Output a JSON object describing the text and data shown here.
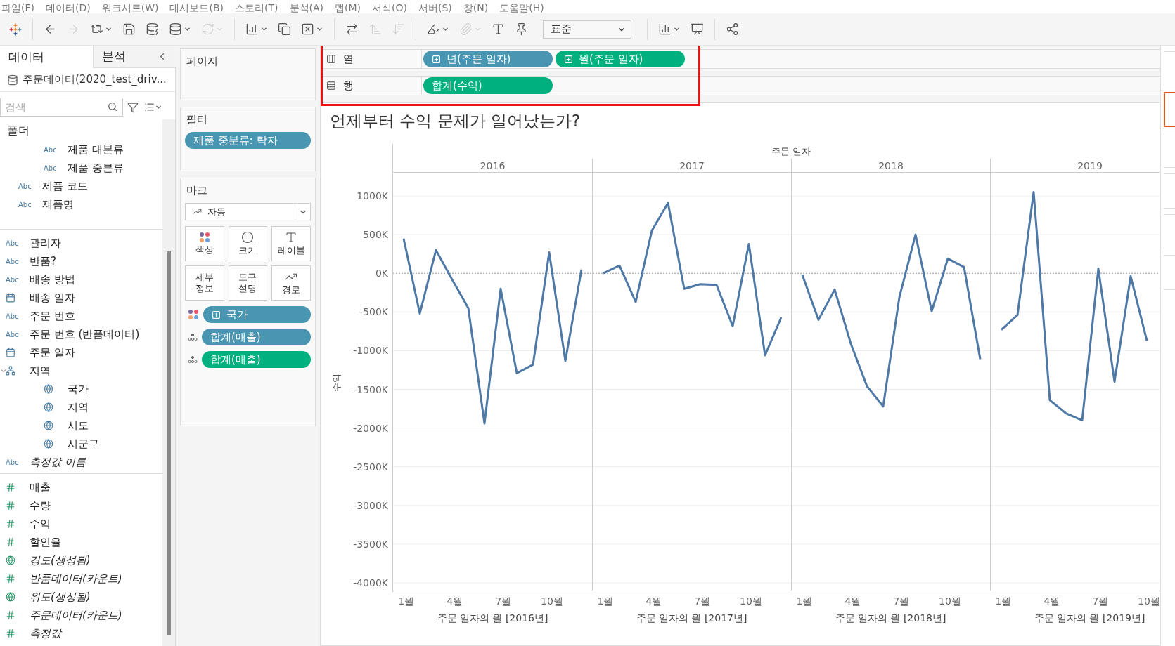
{
  "menu_bar": [
    "파일(F)",
    "데이터(D)",
    "워크시트(W)",
    "대시보드(B)",
    "스토리(T)",
    "분석(A)",
    "맵(M)",
    "서식(O)",
    "서버(S)",
    "창(N)",
    "도움말(H)"
  ],
  "toolbar": [
    {
      "kind": "logo"
    },
    {
      "kind": "separator"
    },
    {
      "kind": "back",
      "disabled": false,
      "menu": false
    },
    {
      "kind": "forward",
      "disabled": true,
      "menu": false
    },
    {
      "kind": "redo",
      "disabled": false,
      "menu": true
    },
    {
      "kind": "save",
      "disabled": false,
      "menu": false
    },
    {
      "kind": "new_datasource",
      "disabled": false,
      "menu": false
    },
    {
      "kind": "pause",
      "disabled": false,
      "menu": true
    },
    {
      "kind": "refresh",
      "disabled": true,
      "menu": true
    },
    {
      "kind": "separator"
    },
    {
      "kind": "new_sheet",
      "disabled": false,
      "menu": true
    },
    {
      "kind": "duplicate",
      "disabled": false,
      "menu": false
    },
    {
      "kind": "clear",
      "disabled": false,
      "menu": true
    },
    {
      "kind": "separator"
    },
    {
      "kind": "swap",
      "disabled": false,
      "menu": false
    },
    {
      "kind": "sort_asc",
      "disabled": true,
      "menu": false
    },
    {
      "kind": "sort_desc",
      "disabled": true,
      "menu": false
    },
    {
      "kind": "separator"
    },
    {
      "kind": "highlight",
      "disabled": false,
      "menu": true
    },
    {
      "kind": "annotate",
      "disabled": true,
      "menu": true
    },
    {
      "kind": "text",
      "disabled": false,
      "menu": false
    },
    {
      "kind": "pin",
      "disabled": false,
      "menu": false
    },
    {
      "kind": "select",
      "value": "표준"
    },
    {
      "kind": "separator"
    },
    {
      "kind": "show_me",
      "disabled": false,
      "menu": true
    },
    {
      "kind": "present",
      "disabled": false,
      "menu": false
    },
    {
      "kind": "separator"
    },
    {
      "kind": "share",
      "disabled": false,
      "menu": false
    }
  ],
  "data_pane": {
    "tabs": [
      {
        "label": "데이터",
        "selected": true
      },
      {
        "label": "분석",
        "selected": false
      }
    ],
    "datasource": "주문데이터(2020_test_driv...",
    "search": {
      "placeholder": "검색"
    },
    "folder_heading": "폴더",
    "sections": [
      {
        "measures": false,
        "items": [
          {
            "children": [
              {
                "kind": "text",
                "type_label": "Abc",
                "label": "제품 대분류",
                "italic": false
              },
              {
                "kind": "text",
                "type_label": "Abc",
                "label": "제품 중분류",
                "italic": false
              }
            ]
          },
          {
            "kind": "text",
            "type_label": "Abc",
            "label": "제품 코드",
            "italic": false
          },
          {
            "kind": "text",
            "type_label": "Abc",
            "label": "제품명",
            "italic": false
          }
        ]
      },
      {
        "measures": false,
        "items": [
          {
            "kind": "text",
            "type_label": "Abc",
            "label": "관리자",
            "italic": false
          },
          {
            "kind": "text",
            "type_label": "Abc",
            "label": "반품?",
            "italic": false
          },
          {
            "kind": "text",
            "type_label": "Abc",
            "label": "배송 방법",
            "italic": false
          },
          {
            "kind": "date",
            "label": "배송 일자",
            "italic": false
          },
          {
            "kind": "text",
            "type_label": "Abc",
            "label": "주문 번호",
            "italic": false
          },
          {
            "kind": "text",
            "type_label": "Abc",
            "label": "주문 번호 (반품데이터)",
            "italic": false
          },
          {
            "kind": "date",
            "label": "주문 일자",
            "italic": false
          },
          {
            "kind": "hierarchy",
            "label": "지역",
            "italic": false,
            "expanded": true,
            "children": [
              {
                "kind": "geo",
                "label": "국가",
                "italic": false
              },
              {
                "kind": "geo",
                "label": "지역",
                "italic": false
              },
              {
                "kind": "geo",
                "label": "시도",
                "italic": false
              },
              {
                "kind": "geo",
                "label": "시군구",
                "italic": false
              }
            ]
          },
          {
            "kind": "text",
            "type_label": "Abc",
            "label": "측정값 이름",
            "italic": true
          }
        ]
      },
      {
        "measures": true,
        "items": [
          {
            "kind": "number",
            "label": "매출",
            "italic": false
          },
          {
            "kind": "number",
            "label": "수량",
            "italic": false
          },
          {
            "kind": "number",
            "label": "수익",
            "italic": false
          },
          {
            "kind": "number",
            "label": "할인율",
            "italic": false
          },
          {
            "kind": "geo",
            "label": "경도(생성됨)",
            "italic": true
          },
          {
            "kind": "number",
            "label": "반품데이터(카운트)",
            "italic": true
          },
          {
            "kind": "geo",
            "label": "위도(생성됨)",
            "italic": true
          },
          {
            "kind": "number",
            "label": "주문데이터(카운트)",
            "italic": true
          },
          {
            "kind": "number",
            "label": "측정값",
            "italic": true
          }
        ]
      }
    ]
  },
  "pages_card": {
    "title": "페이지"
  },
  "filters_card": {
    "title": "필터",
    "pills": [
      {
        "label": "제품 중분류: 탁자",
        "continuous": false
      }
    ]
  },
  "marks_card": {
    "title": "마크",
    "mark_type": "자동",
    "buttons": [
      {
        "kind": "color",
        "label": "색상"
      },
      {
        "kind": "size",
        "label": "크기"
      },
      {
        "kind": "label",
        "label": "레이블"
      },
      {
        "kind": "detail",
        "label": "세부 정보"
      },
      {
        "kind": "tooltip",
        "label": "도구 설명"
      },
      {
        "kind": "path",
        "label": "경로"
      }
    ],
    "pills": [
      {
        "kind": "color",
        "label": "국가",
        "continuous": false,
        "expandable": true
      },
      {
        "kind": "detail",
        "label": "합계(매출)",
        "continuous": false,
        "expandable": false
      },
      {
        "kind": "detail",
        "label": "합계(매출)",
        "continuous": true,
        "expandable": false
      }
    ]
  },
  "shelves": {
    "highlighted": true,
    "rows": [
      {
        "kind": "columns",
        "label": "열",
        "pills": [
          {
            "label": "년(주문 일자)",
            "continuous": false,
            "expandable": true
          },
          {
            "label": "월(주문 일자)",
            "continuous": true,
            "expandable": true
          }
        ]
      },
      {
        "kind": "rows",
        "label": "행",
        "pills": [
          {
            "label": "합계(수익)",
            "continuous": true,
            "expandable": false
          }
        ]
      }
    ]
  },
  "sheet": {
    "title": "언제부터 수익 문제가 일어났는가?",
    "column_header": "주문 일자",
    "panes": [
      {
        "header": "2016",
        "chart_data": {
          "type": "line",
          "xlabel": "주문 일자의 월 [2016년]",
          "ylabel": "수익",
          "x": [
            1,
            2,
            3,
            4,
            5,
            6,
            7,
            8,
            9,
            10,
            11,
            12
          ],
          "xlim": [
            0.35,
            12.65
          ],
          "ylim": [
            -4100,
            1300
          ],
          "xticks": [
            {
              "value": 1,
              "label": "1월"
            },
            {
              "value": 4,
              "label": "4월"
            },
            {
              "value": 7,
              "label": "7월"
            },
            {
              "value": 10,
              "label": "10월"
            }
          ],
          "yticks": [
            {
              "value": 1000,
              "label": "1000K"
            },
            {
              "value": 500,
              "label": "500K"
            },
            {
              "value": 0,
              "label": "0K"
            },
            {
              "value": -500,
              "label": "-500K"
            },
            {
              "value": -1000,
              "label": "-1000K"
            },
            {
              "value": -1500,
              "label": "-1500K"
            },
            {
              "value": -2000,
              "label": "-2000K"
            },
            {
              "value": -2500,
              "label": "-2500K"
            },
            {
              "value": -3000,
              "label": "-3000K"
            },
            {
              "value": -3500,
              "label": "-3500K"
            },
            {
              "value": -4000,
              "label": "-4000K"
            }
          ],
          "grid": true,
          "ref_lines": [
            {
              "axis": "y",
              "value": 0
            }
          ],
          "series": [
            {
              "color": "#4e79a7",
              "values": [
                450,
                -520,
                300,
                -80,
                -450,
                -1940,
                -200,
                -1290,
                -1180,
                270,
                -1130,
                50
              ]
            }
          ]
        }
      },
      {
        "header": "2017",
        "chart_data": {
          "type": "line",
          "xlabel": "주문 일자의 월 [2017년]",
          "x": [
            1,
            2,
            3,
            4,
            5,
            6,
            7,
            8,
            9,
            10,
            11,
            12
          ],
          "xlim": [
            0.35,
            12.65
          ],
          "ylim": [
            -4100,
            1300
          ],
          "xticks": [
            {
              "value": 1,
              "label": "1월"
            },
            {
              "value": 4,
              "label": "4월"
            },
            {
              "value": 7,
              "label": "7월"
            },
            {
              "value": 10,
              "label": "10월"
            }
          ],
          "grid": true,
          "ref_lines": [
            {
              "axis": "y",
              "value": 0
            }
          ],
          "series": [
            {
              "color": "#4e79a7",
              "values": [
                0,
                100,
                -370,
                550,
                910,
                -200,
                -140,
                -150,
                -680,
                380,
                -1060,
                -570
              ]
            }
          ]
        }
      },
      {
        "header": "2018",
        "chart_data": {
          "type": "line",
          "xlabel": "주문 일자의 월 [2018년]",
          "x": [
            1,
            2,
            3,
            4,
            5,
            6,
            7,
            8,
            9,
            10,
            11,
            12
          ],
          "xlim": [
            0.35,
            12.65
          ],
          "ylim": [
            -4100,
            1300
          ],
          "xticks": [
            {
              "value": 1,
              "label": "1월"
            },
            {
              "value": 4,
              "label": "4월"
            },
            {
              "value": 7,
              "label": "7월"
            },
            {
              "value": 10,
              "label": "10월"
            }
          ],
          "grid": true,
          "ref_lines": [
            {
              "axis": "y",
              "value": 0
            }
          ],
          "series": [
            {
              "color": "#4e79a7",
              "values": [
                -20,
                -600,
                -210,
                -910,
                -1460,
                -1720,
                -310,
                500,
                -490,
                190,
                80,
                -1110
              ]
            }
          ]
        }
      },
      {
        "header": "2019",
        "chart_data": {
          "type": "line",
          "xlabel": "주문 일자의 월 [2019년]",
          "x": [
            1,
            2,
            3,
            4,
            5,
            6,
            7,
            8,
            9,
            10
          ],
          "xlim": [
            0.35,
            12.65
          ],
          "ylim": [
            -4100,
            1300
          ],
          "xticks": [
            {
              "value": 1,
              "label": "1월"
            },
            {
              "value": 4,
              "label": "4월"
            },
            {
              "value": 7,
              "label": "7월"
            },
            {
              "value": 10,
              "label": "10월"
            }
          ],
          "grid": true,
          "ref_lines": [
            {
              "axis": "y",
              "value": 0
            }
          ],
          "series": [
            {
              "color": "#4e79a7",
              "values": [
                -730,
                -540,
                1050,
                -1640,
                -1810,
                -1900,
                60,
                -1400,
                -40,
                -870
              ]
            }
          ]
        }
      }
    ]
  }
}
